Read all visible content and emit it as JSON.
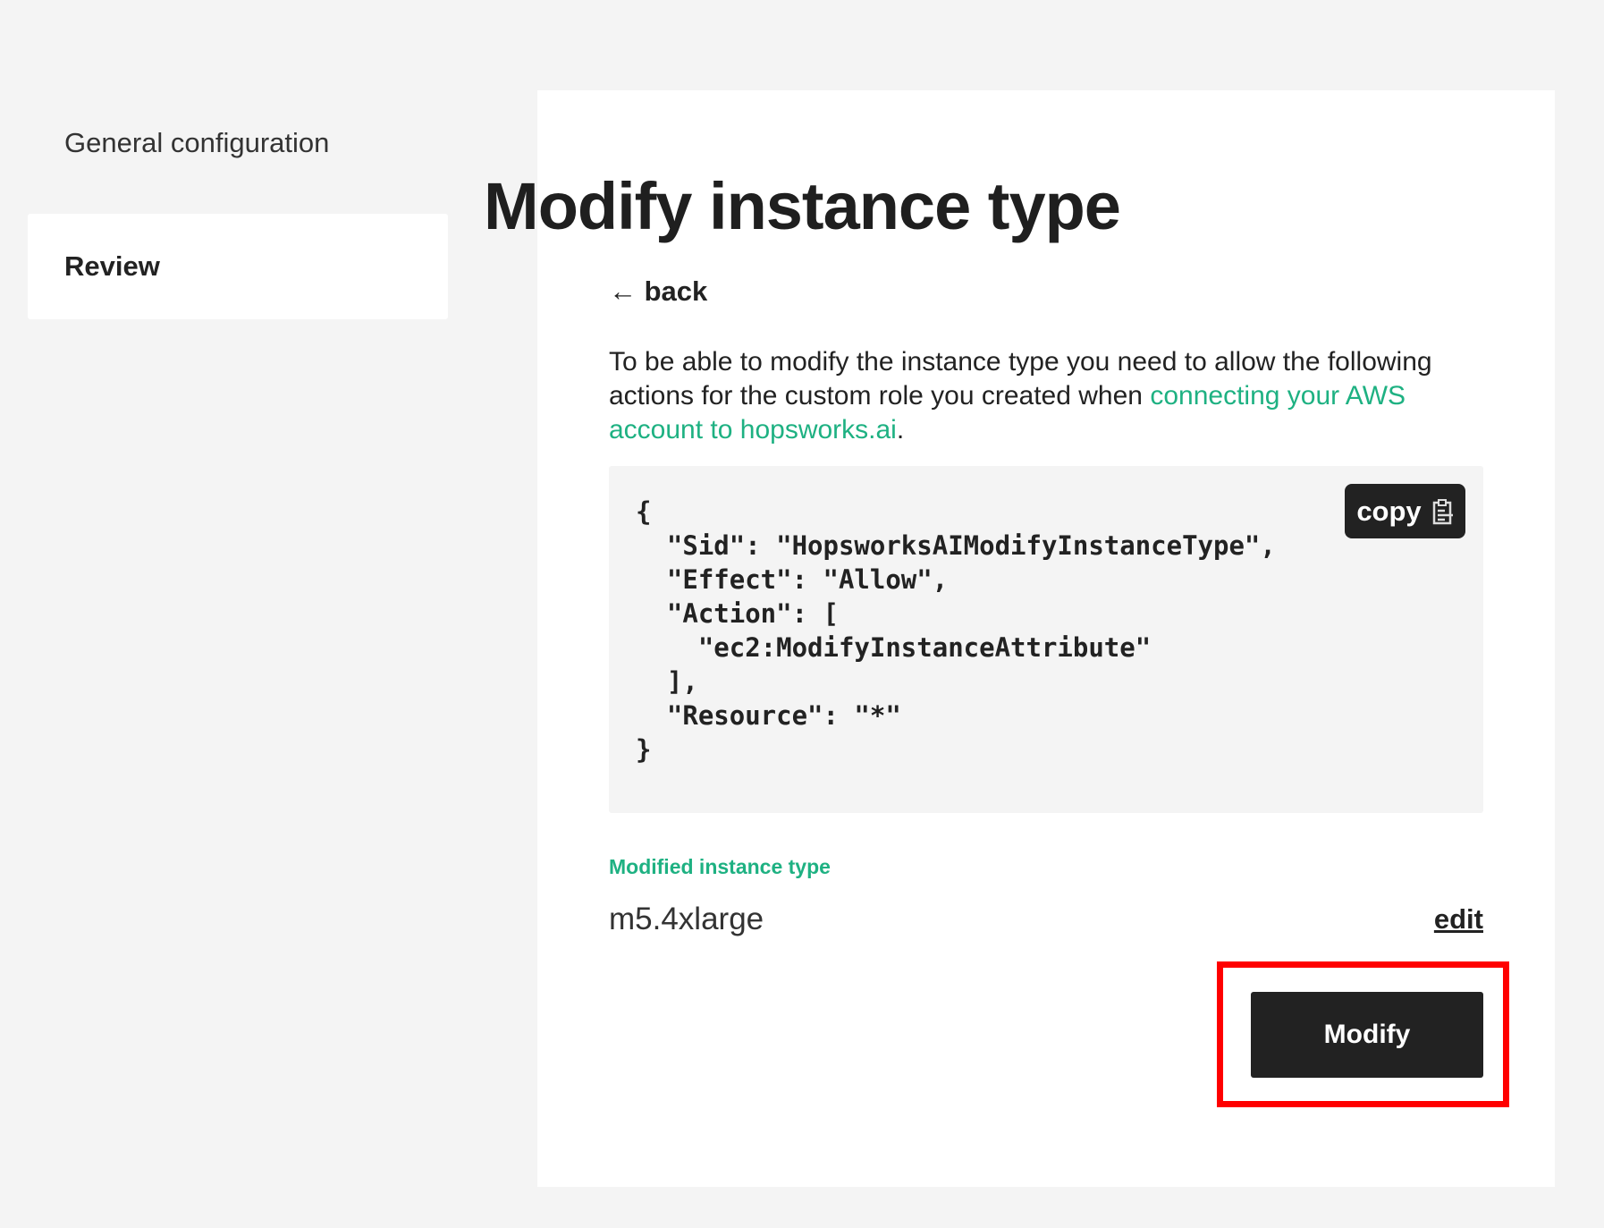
{
  "sidebar": {
    "items": [
      {
        "label": "General configuration"
      },
      {
        "label": "Review"
      }
    ]
  },
  "main": {
    "title": "Modify instance type",
    "back_label": "← back",
    "description_prefix": "To be able to modify the instance type you need to allow the following actions for the custom role you created when ",
    "description_link": "connecting your AWS account to hopsworks.ai",
    "description_suffix": ".",
    "code": "{\n  \"Sid\": \"HopsworksAIModifyInstanceType\",\n  \"Effect\": \"Allow\",\n  \"Action\": [\n    \"ec2:ModifyInstanceAttribute\"\n  ],\n  \"Resource\": \"*\"\n}",
    "copy_label": "copy",
    "field_label": "Modified instance type",
    "field_value": "m5.4xlarge",
    "edit_label": "edit",
    "modify_label": "Modify"
  },
  "colors": {
    "accent": "#1eb182",
    "highlight": "#ff0000",
    "button": "#222222"
  }
}
